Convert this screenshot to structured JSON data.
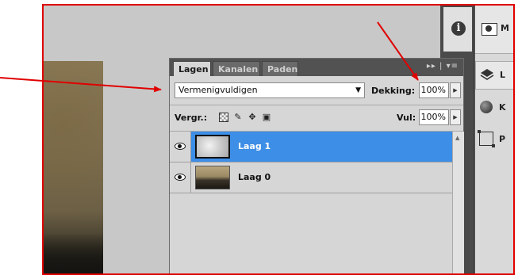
{
  "layers_panel": {
    "tabs": [
      {
        "label": "Lagen",
        "active": true
      },
      {
        "label": "Kanalen",
        "active": false
      },
      {
        "label": "Paden",
        "active": false
      }
    ],
    "menu_glyph": "▸▸ | ▾≡",
    "blend_mode": "Vermenigvuldigen",
    "opacity_label": "Dekking:",
    "opacity_value": "100%",
    "lock_label": "Vergr.:",
    "fill_label": "Vul:",
    "fill_value": "100%",
    "layers": [
      {
        "name": "Laag 1",
        "selected": true,
        "visible": true
      },
      {
        "name": "Laag 0",
        "selected": false,
        "visible": true
      }
    ]
  },
  "dock": {
    "info_glyph": "i",
    "mask_letter": "M",
    "layers_letter": "L",
    "channels_letter": "K",
    "paths_letter": "P"
  },
  "colors": {
    "selection": "#3d8ee6",
    "annotation": "#e00000",
    "panel_bg": "#d6d6d6",
    "panel_header": "#525252"
  }
}
